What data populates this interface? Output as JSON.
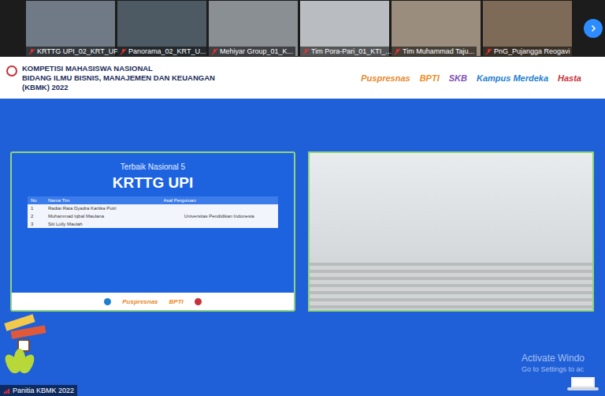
{
  "participants": [
    {
      "name": "KRTTG UPI_02_KRT_UPI",
      "muted": true,
      "color": "#6f7a86"
    },
    {
      "name": "Panorama_02_KRT_U...",
      "muted": true,
      "color": "#4d5a63"
    },
    {
      "name": "Mehiyar Group_01_K...",
      "muted": true,
      "color": "#8a8f94"
    },
    {
      "name": "Tim Pora-Pari_01_KTI_...",
      "muted": true,
      "color": "#b9bdc2"
    },
    {
      "name": "Tim Muhammad Taju...",
      "muted": true,
      "color": "#9a8d7d"
    },
    {
      "name": "PnG_Pujangga Reogavi",
      "muted": true,
      "color": "#7d6a57"
    }
  ],
  "slide": {
    "header": {
      "title_lines": [
        "KOMPETISI MAHASISWA NASIONAL",
        "BIDANG ILMU BISNIS, MANAJEMEN DAN KEUANGAN",
        "(KBMK) 2022"
      ],
      "logos": [
        {
          "text": "Puspresnas",
          "color": "#e8892b"
        },
        {
          "text": "BPTI",
          "color": "#f08a1c"
        },
        {
          "text": "SKB",
          "color": "#7b4fb3"
        },
        {
          "text": "Kampus Merdeka",
          "color": "#1e7fd0"
        },
        {
          "text": "Hasta",
          "color": "#c8323a"
        }
      ]
    },
    "card": {
      "subtitle": "Terbaik Nasional 5",
      "team": "KRTTG UPI",
      "columns": [
        "No",
        "Nama Tim",
        "Asal Perguruan"
      ],
      "rows": [
        {
          "no": "1",
          "name": "Radiai Rata Dyadra Kartika Putri"
        },
        {
          "no": "2",
          "name": "Muhammad Iqbal Maulana"
        },
        {
          "no": "3",
          "name": "Siti Lolly Maulah"
        }
      ],
      "institution": "Universitas Pendidikan Indonesia",
      "footer_logos": [
        {
          "text": "Puspresnas",
          "color": "#e8892b"
        },
        {
          "text": "BPTI",
          "color": "#f08a1c"
        }
      ]
    }
  },
  "host_label": "Panitia KBMK 2022",
  "watermark": [
    "Activate Windo",
    "Go to Settings to ac"
  ]
}
